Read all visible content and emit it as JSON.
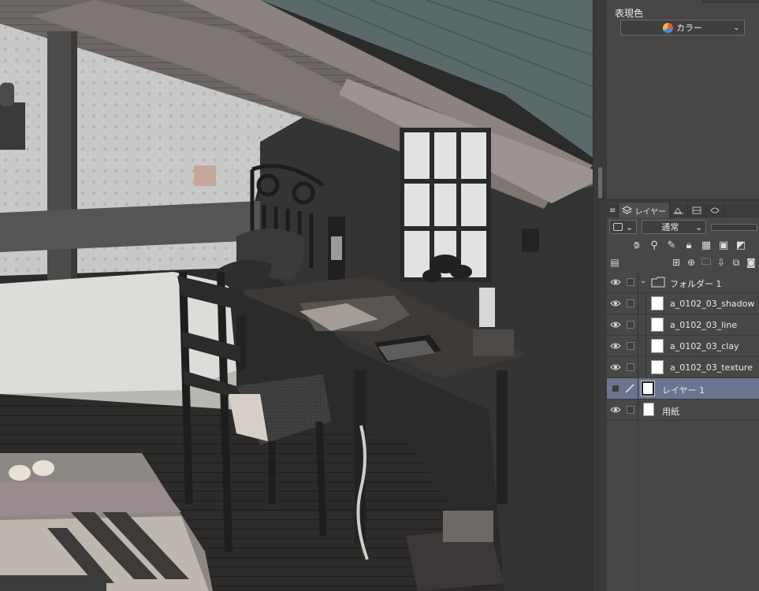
{
  "expression_color": {
    "label": "表現色",
    "value": "カラー",
    "icon": "color-wheel-icon"
  },
  "layer_tab": {
    "label": "レイヤー"
  },
  "blend_mode": {
    "value": "通常"
  },
  "layers": [
    {
      "name": "フォルダー 1",
      "type": "folder",
      "visible": true
    },
    {
      "name": "a_0102_03_shadow",
      "type": "raster",
      "visible": true
    },
    {
      "name": "a_0102_03_line",
      "type": "raster",
      "visible": true
    },
    {
      "name": "a_0102_03_clay",
      "type": "raster",
      "visible": true
    },
    {
      "name": "a_0102_03_texture",
      "type": "raster",
      "visible": true
    },
    {
      "name": "レイヤー 1",
      "type": "raster",
      "visible": false,
      "selected": true
    },
    {
      "name": "用紙",
      "type": "paper",
      "visible": true
    }
  ],
  "colors": {
    "panel_bg": "#474747",
    "selected_row": "#6b7590",
    "canvas_dark": "#2a2a2a"
  }
}
